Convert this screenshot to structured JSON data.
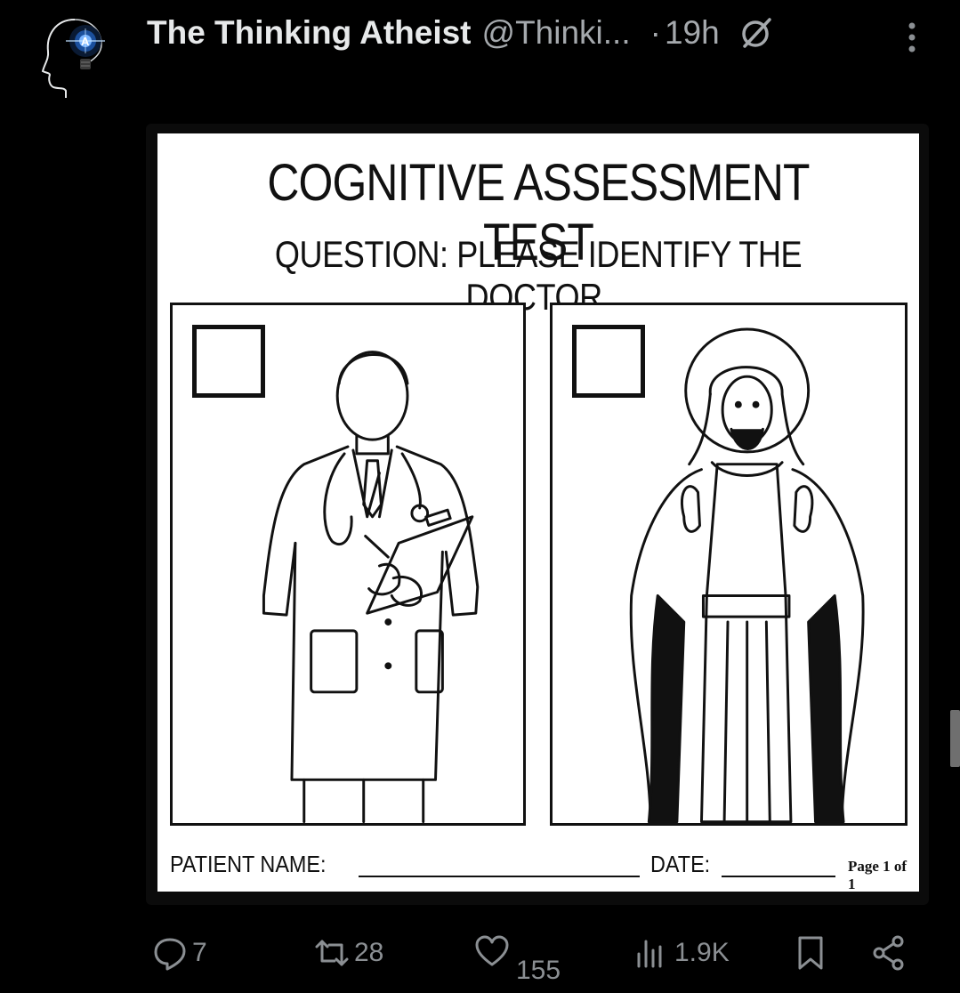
{
  "post": {
    "author_name": "The Thinking Atheist",
    "author_handle": "@Thinki...",
    "separator": "·",
    "time": "19h"
  },
  "image": {
    "title": "COGNITIVE ASSESSMENT TEST",
    "question": "QUESTION: PLEASE IDENTIFY THE DOCTOR.",
    "patient_label": "PATIENT NAME:",
    "date_label": "DATE:",
    "page_label": "Page 1 of 1"
  },
  "actions": {
    "replies": "7",
    "reposts": "28",
    "likes": "155",
    "views": "1.9K"
  },
  "icons": {
    "avatar": "atheist-logo-head-icon",
    "grok": "grok-icon",
    "more": "more-vertical-icon",
    "reply": "reply-icon",
    "repost": "repost-icon",
    "like": "heart-icon",
    "views": "views-chart-icon",
    "bookmark": "bookmark-icon",
    "share": "share-icon"
  },
  "colors": {
    "background": "#000000",
    "text_primary": "#e7e9ea",
    "text_secondary": "#8b8f93",
    "logo_accent": "#2f7fd8"
  }
}
